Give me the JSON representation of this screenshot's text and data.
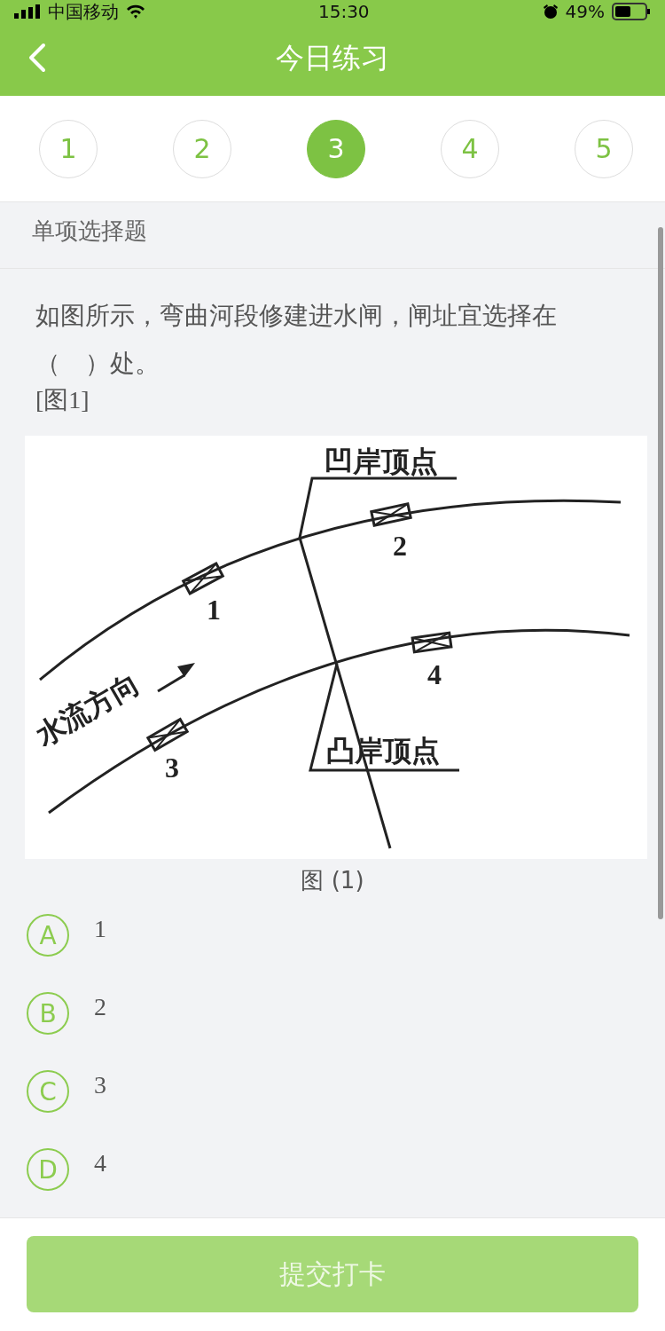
{
  "status_bar": {
    "carrier": "中国移动",
    "time": "15:30",
    "battery": "49%"
  },
  "header": {
    "title": "今日练习"
  },
  "question_numbers": [
    {
      "label": "1",
      "selected": false
    },
    {
      "label": "2",
      "selected": false
    },
    {
      "label": "3",
      "selected": true
    },
    {
      "label": "4",
      "selected": false
    },
    {
      "label": "5",
      "selected": false
    }
  ],
  "question_type": "单项选择题",
  "question_text": "如图所示，弯曲河段修建进水闸，闸址宜选择在（　）处。",
  "figure_ref": "[图1]",
  "figure": {
    "concave_label": "凹岸顶点",
    "convex_label": "凸岸顶点",
    "flow_label": "水流方向",
    "gate_labels": [
      "1",
      "2",
      "3",
      "4"
    ],
    "caption": "图 (1)"
  },
  "options": [
    {
      "letter": "A",
      "text": "1",
      "selected": false
    },
    {
      "letter": "B",
      "text": "2",
      "selected": false
    },
    {
      "letter": "C",
      "text": "3",
      "selected": false
    },
    {
      "letter": "D",
      "text": "4",
      "selected": false
    }
  ],
  "submit_button": {
    "label": "提交打卡",
    "disabled": true
  }
}
